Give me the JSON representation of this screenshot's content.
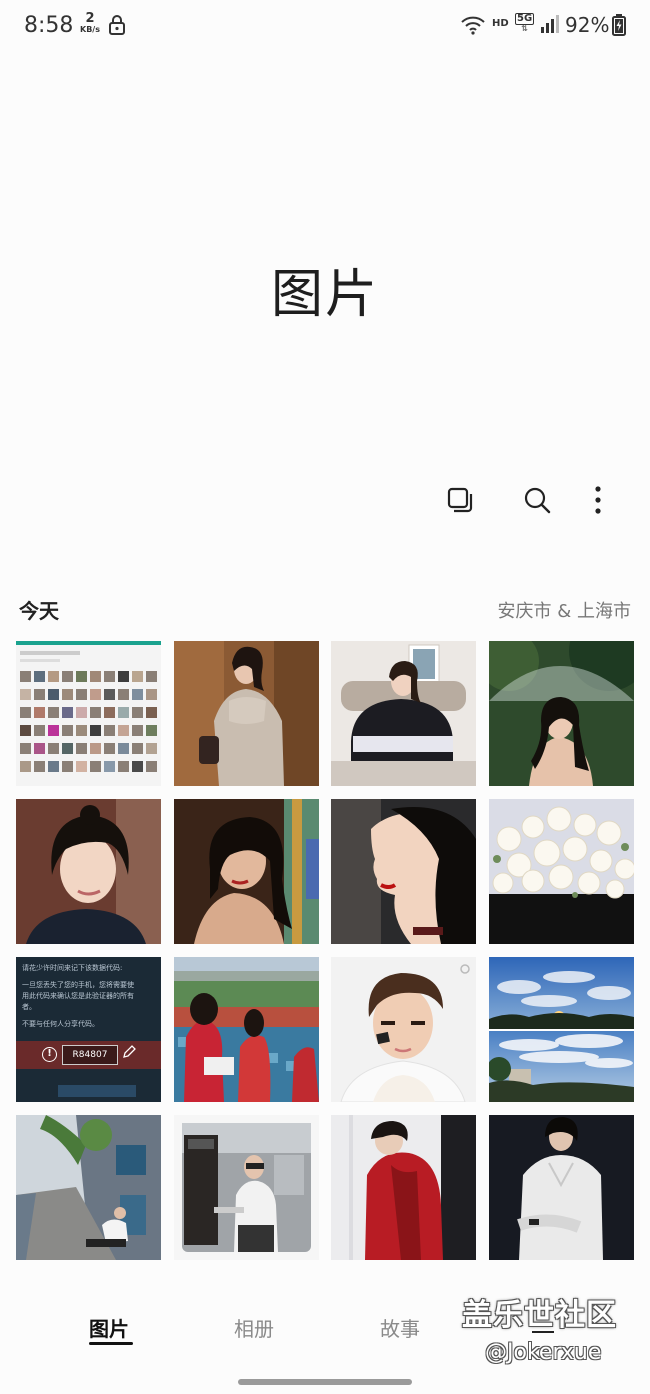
{
  "status_bar": {
    "time": "8:58",
    "net_speed_value": "2",
    "net_speed_unit": "KB/s",
    "network_hd": "HD",
    "network_5g": "5G",
    "battery_percent": "92%"
  },
  "header": {
    "title": "图片"
  },
  "toolbar": {
    "icons": [
      "select-multiple-icon",
      "search-icon",
      "more-options-icon"
    ]
  },
  "section": {
    "date_label": "今天",
    "location_label": "安庆市 & 上海市"
  },
  "verification_tile": {
    "line1": "请花少许时间来记下该数据代码:",
    "line2": "一旦您丢失了您的手机，您将需要使",
    "line3": "用此代码来确认您是此验证器的所有",
    "line4": "者。",
    "line5": "不要与任何人分享代码。",
    "code": "R84807"
  },
  "bottom_nav": {
    "tabs": [
      {
        "label": "图片",
        "active": true
      },
      {
        "label": "相册",
        "active": false
      },
      {
        "label": "故事",
        "active": false
      }
    ]
  },
  "watermark": {
    "site": "盖乐世社区",
    "handle": "@Jokerxue"
  }
}
